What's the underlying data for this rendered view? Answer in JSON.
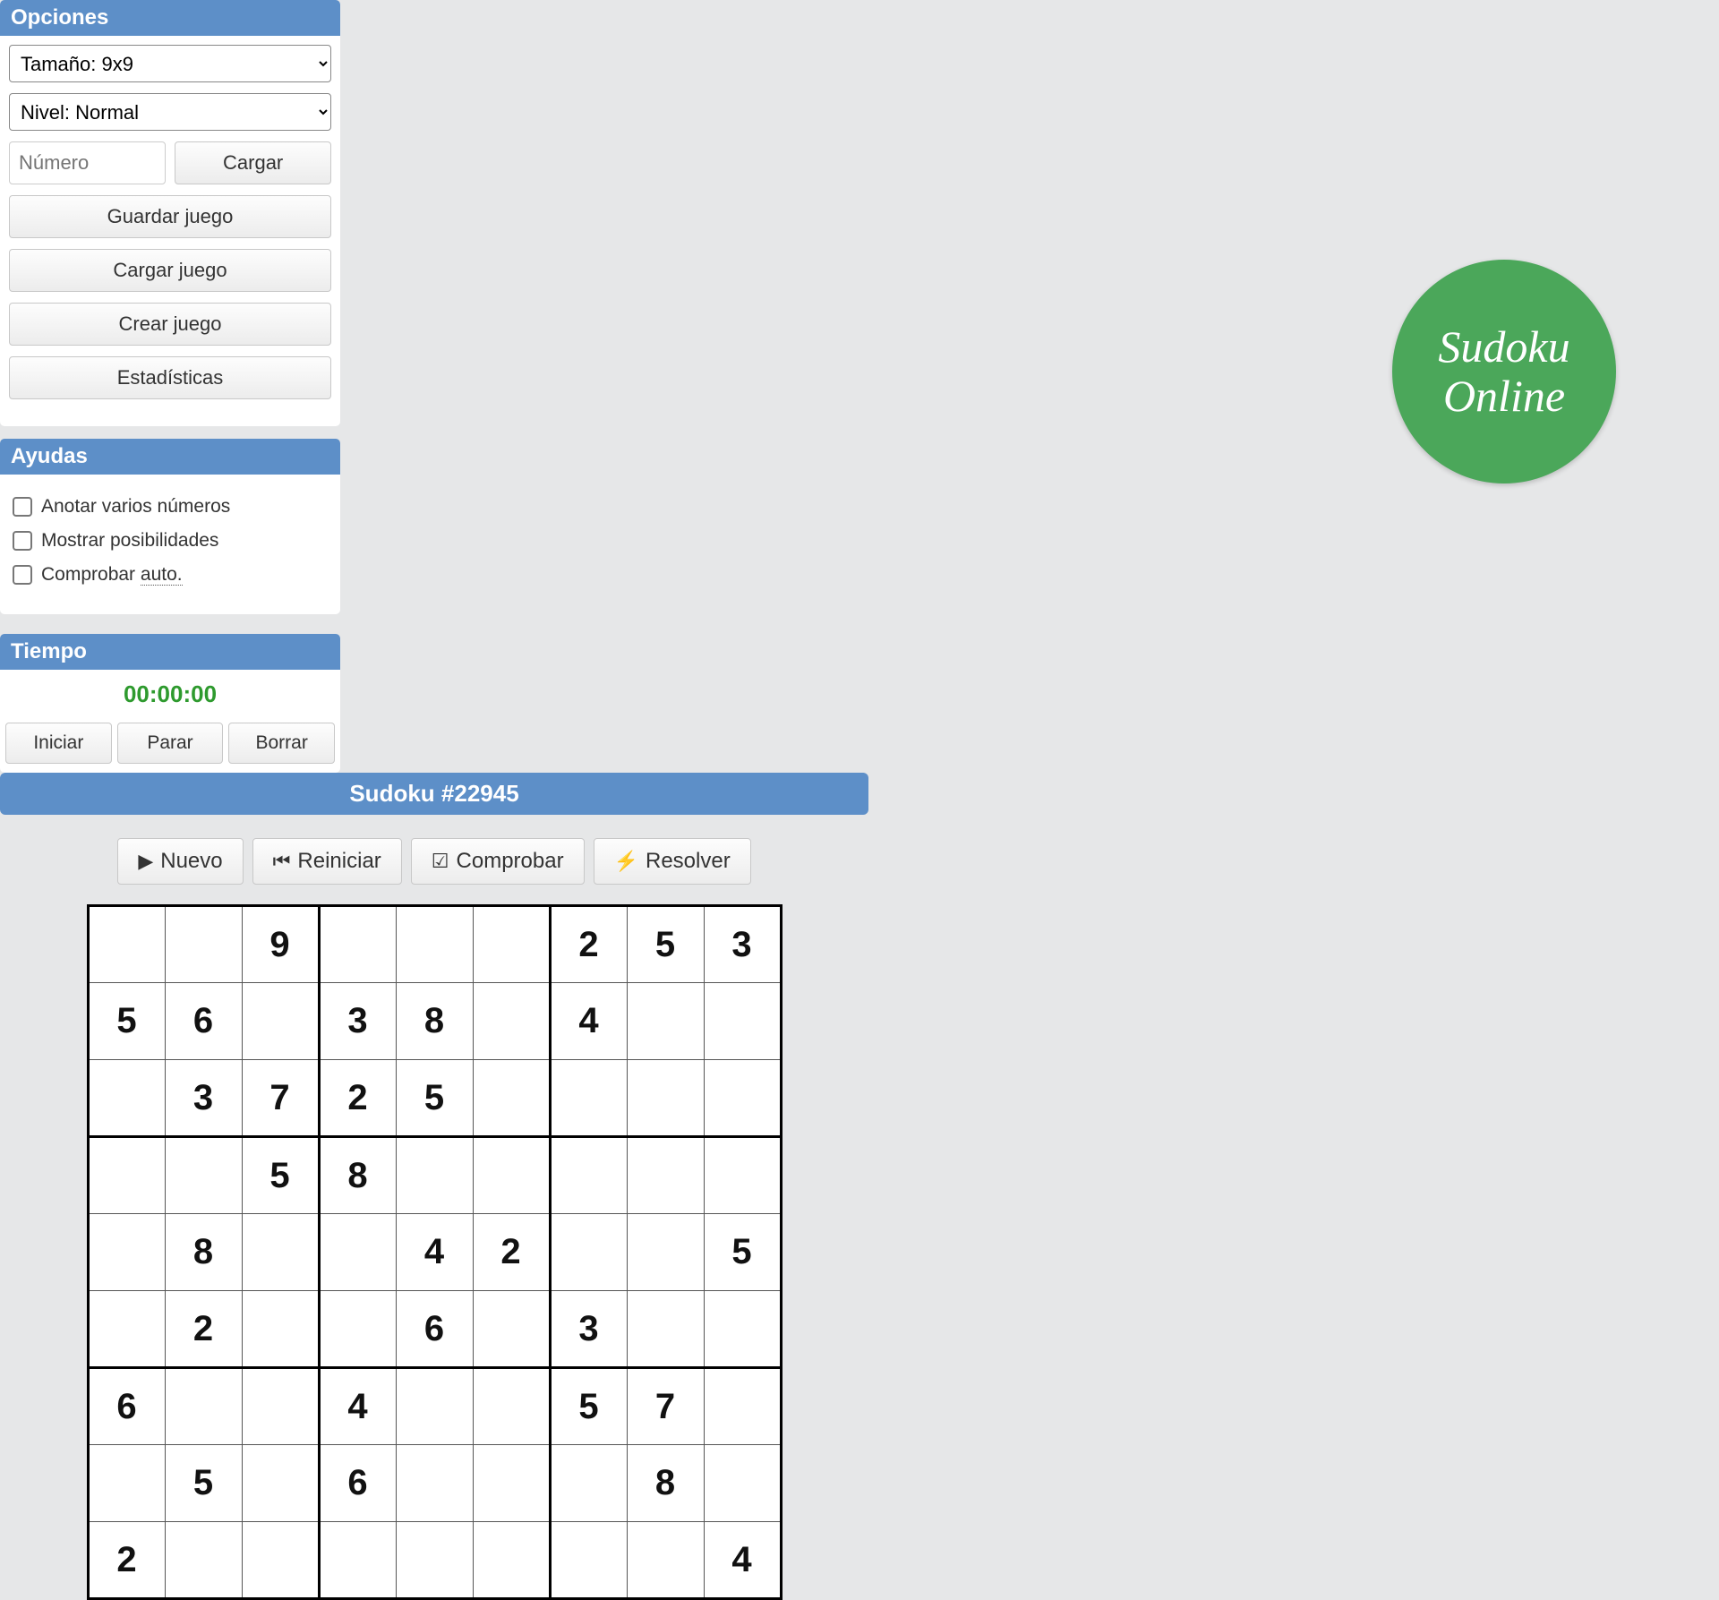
{
  "sidebar": {
    "options_header": "Opciones",
    "size_select": "Tamaño: 9x9",
    "level_select": "Nivel: Normal",
    "number_placeholder": "Número",
    "load_btn": "Cargar",
    "save_game_btn": "Guardar juego",
    "load_game_btn": "Cargar juego",
    "create_game_btn": "Crear juego",
    "stats_btn": "Estadísticas",
    "helps_header": "Ayudas",
    "chk_multi": "Anotar varios números",
    "chk_possibilities": "Mostrar posibilidades",
    "chk_autocheck_prefix": "Comprobar ",
    "chk_autocheck_suffix": "auto.",
    "time_header": "Tiempo",
    "time_value": "00:00:00",
    "start_btn": "Iniciar",
    "stop_btn": "Parar",
    "clear_btn": "Borrar"
  },
  "main": {
    "title": "Sudoku #22945",
    "new_btn": "Nuevo",
    "restart_btn": "Reiniciar",
    "check_btn": "Comprobar",
    "solve_btn": "Resolver",
    "grid": [
      [
        "",
        "",
        "9",
        "",
        "",
        "",
        "2",
        "5",
        "3"
      ],
      [
        "5",
        "6",
        "",
        "3",
        "8",
        "",
        "4",
        "",
        ""
      ],
      [
        "",
        "3",
        "7",
        "2",
        "5",
        "",
        "",
        "",
        ""
      ],
      [
        "",
        "",
        "5",
        "8",
        "",
        "",
        "",
        "",
        ""
      ],
      [
        "",
        "8",
        "",
        "",
        "4",
        "2",
        "",
        "",
        "5"
      ],
      [
        "",
        "2",
        "",
        "",
        "6",
        "",
        "3",
        "",
        ""
      ],
      [
        "6",
        "",
        "",
        "4",
        "",
        "",
        "5",
        "7",
        ""
      ],
      [
        "",
        "5",
        "",
        "6",
        "",
        "",
        "",
        "8",
        ""
      ],
      [
        "2",
        "",
        "",
        "",
        "",
        "",
        "",
        "",
        "4"
      ]
    ]
  },
  "badge": {
    "line1": "Sudoku",
    "line2": "Online"
  }
}
